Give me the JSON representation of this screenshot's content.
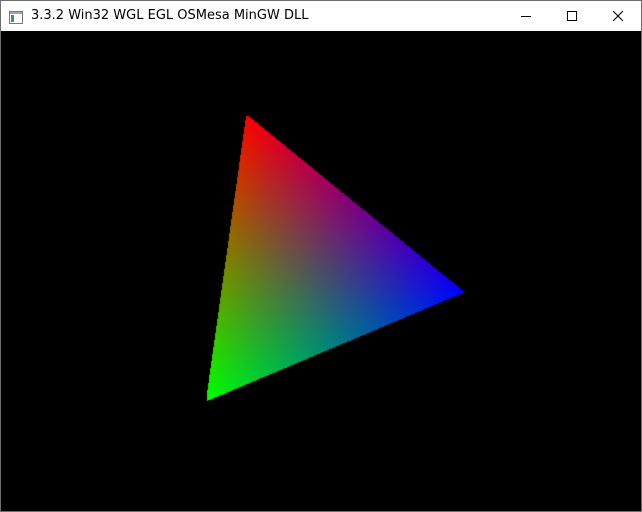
{
  "window": {
    "title": "3.3.2 Win32 WGL EGL OSMesa MinGW DLL",
    "icon": "application-window-icon",
    "controls": {
      "minimize_icon": "minimize-icon",
      "maximize_icon": "maximize-icon",
      "close_icon": "close-icon"
    }
  },
  "scene": {
    "background": "#000000",
    "triangle": {
      "vertex_colors": [
        "#ff0000",
        "#00ff00",
        "#0000ff"
      ]
    }
  }
}
